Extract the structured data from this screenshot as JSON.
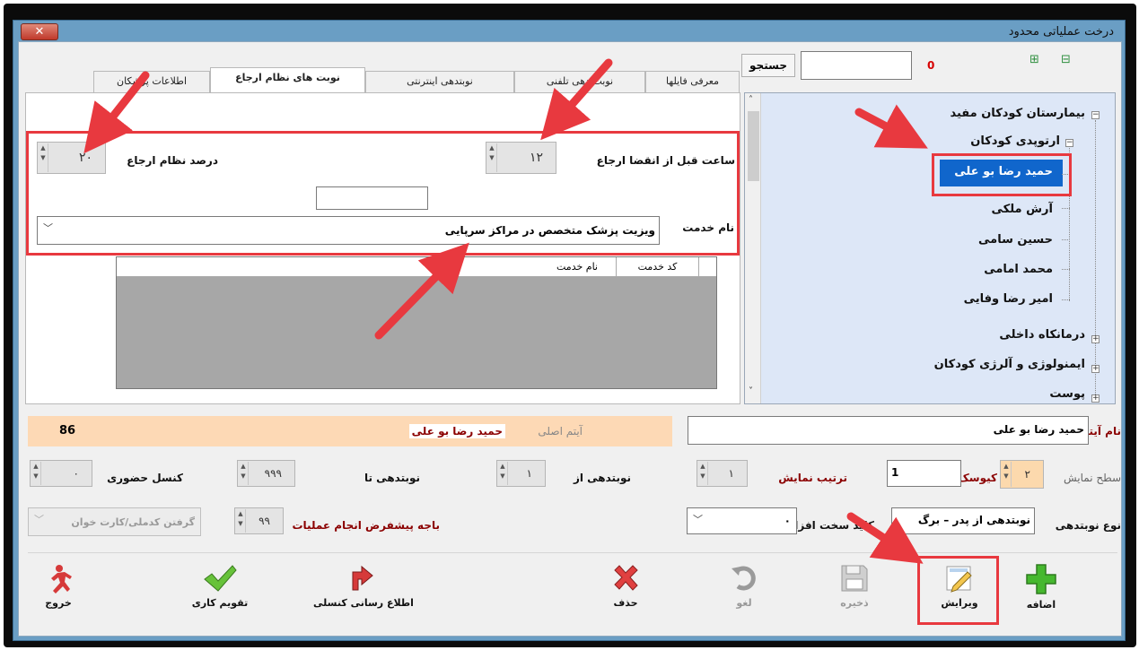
{
  "window": {
    "title": "درخت عملیاتی محدود",
    "close_label": "✕"
  },
  "search": {
    "count": "0",
    "button": "جستجو",
    "value": ""
  },
  "tree": {
    "root": "بیمارستان کودکان مفید",
    "group": "ارتوپدی کودکان",
    "doctors": [
      "حمید رضا بو علی",
      "آرش ملکی",
      "حسین سامی",
      "محمد امامی",
      "امیر رضا وفایی"
    ],
    "others": [
      "درمانکاه داخلی",
      "ایمنولوژی و آلرژی کودکان",
      "پوست"
    ]
  },
  "tabs": [
    "معرفی فایلها",
    "نوبت دهی تلفنی",
    "نوبتدهی اینترنتی",
    "نوبت های نظام ارجاع",
    "اطلاعات پزشکان"
  ],
  "tab_panel": {
    "hours_label": "ساعت قبل از انقضا ارجاع",
    "hours_value": "۱۲",
    "percent_label": "درصد نظام ارجاع",
    "percent_value": "۲۰",
    "service_label": "نام خدمت",
    "service_value": "ویزیت پزشک متخصص در مراکز سرپایی",
    "grid_headers": [
      "کد خدمت",
      "نام خدمت"
    ]
  },
  "form": {
    "item_name_label": "نام آیتم",
    "item_name_value": "حمید رضا بو علی",
    "main_item_label": "آیتم اصلی",
    "main_item_value": "حمید رضا بو علی",
    "main_item_id": "86",
    "display_level_label": "سطح نمایش",
    "display_level_value": "۲",
    "kiosk_label": "کیوسک",
    "kiosk_value": "1",
    "order_label": "ترتیب نمایش",
    "order_value": "۱",
    "from_label": "نوبتدهی از",
    "from_value": "۱",
    "to_label": "نوبتدهی تا",
    "to_value": "۹۹۹",
    "cancel_label": "کنسل حضوری",
    "cancel_value": "۰",
    "type_label": "نوع نوبتدهی",
    "type_value": "نوبتدهی از پدر – برگ",
    "hw_label": "کلید سخت افزاری",
    "hw_value": "۰",
    "op_label": "باجه پیشفرض انجام عملیات",
    "op_value": "۹۹",
    "card_label": "گرفتن کدملی/کارت خوان"
  },
  "toolbar": {
    "add": "اضافه",
    "edit": "ویرایش",
    "save": "ذخیره",
    "undo": "لغو",
    "delete": "حذف",
    "notify": "اطلاع رسانی کنسلی",
    "calendar": "تقویم کاری",
    "exit": "خروج"
  }
}
